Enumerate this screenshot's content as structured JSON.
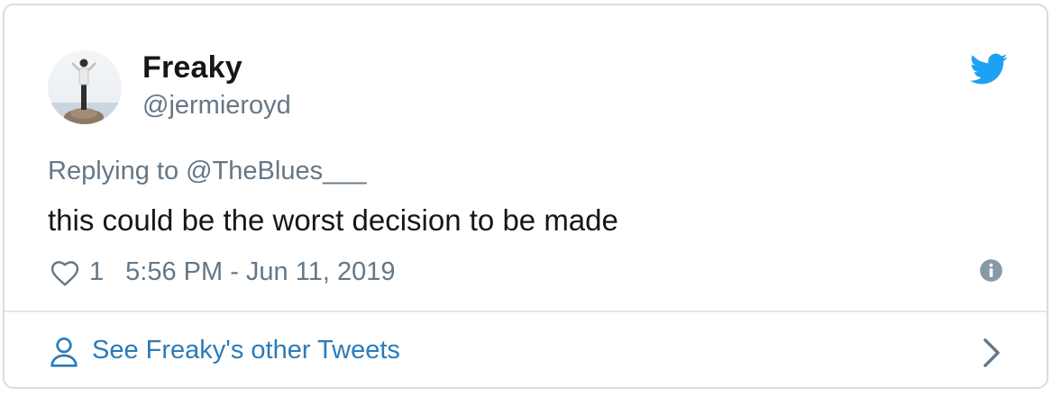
{
  "tweet": {
    "author_name": "Freaky",
    "author_handle": "@jermieroyd",
    "replying_to": "Replying to @TheBlues___",
    "text": "this could be the worst decision to be made",
    "like_count": "1",
    "timestamp": "5:56 PM - Jun 11, 2019"
  },
  "footer": {
    "see_more_label": "See Freaky's other Tweets"
  },
  "icons": {
    "logo": "twitter-bird-icon",
    "like": "heart-icon",
    "info": "info-icon",
    "profile": "person-icon",
    "navigate": "chevron-right-icon"
  },
  "colors": {
    "twitter_blue": "#1da1f2",
    "link_blue": "#2b7bb9",
    "text_primary": "#14171a",
    "text_secondary": "#657786",
    "border": "#d6dde3"
  }
}
